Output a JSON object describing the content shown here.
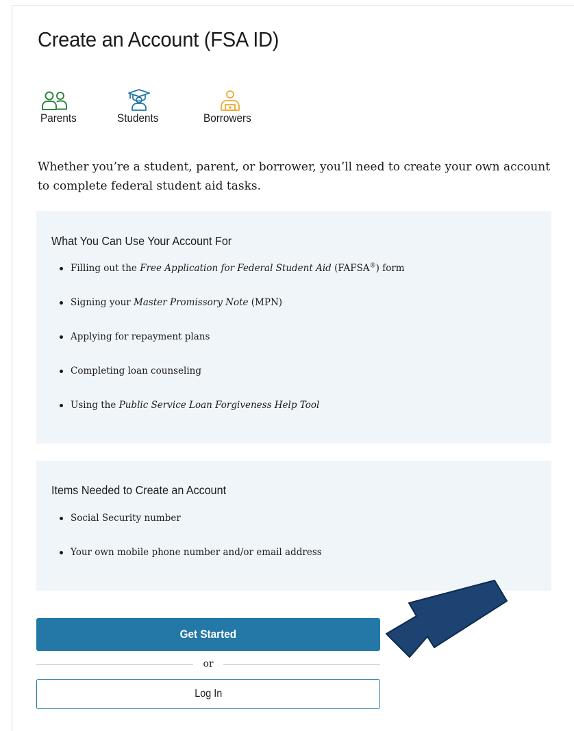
{
  "page": {
    "title": "Create an Account (FSA ID)",
    "intro": "Whether you’re a student, parent, or borrower, you’ll need to create your own account to complete federal student aid tasks."
  },
  "user_types": [
    {
      "label": "Parents",
      "icon": "parents-icon",
      "color": "#2e8540"
    },
    {
      "label": "Students",
      "icon": "graduation-cap-icon",
      "color": "#2378a8"
    },
    {
      "label": "Borrowers",
      "icon": "borrower-icon",
      "color": "#f0a830"
    }
  ],
  "uses_panel": {
    "heading": "What You Can Use Your Account For",
    "items": [
      {
        "before": "Filling out the ",
        "em": "Free Application for Federal Student Aid",
        "after": " (FAFSA",
        "sup": "®",
        "after2": ") form"
      },
      {
        "before": "Signing your ",
        "em": "Master Promissory Note",
        "after": " (MPN)"
      },
      {
        "text": "Applying for repayment plans"
      },
      {
        "text": "Completing loan counseling"
      },
      {
        "before": "Using the ",
        "em": "Public Service Loan Forgiveness Help Tool"
      }
    ]
  },
  "items_panel": {
    "heading": "Items Needed to Create an Account",
    "items": [
      {
        "text": "Social Security number"
      },
      {
        "text": "Your own mobile phone number and/or email address"
      }
    ]
  },
  "actions": {
    "get_started": "Get Started",
    "or": "or",
    "log_in": "Log In"
  },
  "colors": {
    "primary": "#2378a8",
    "panel_bg": "#f0f5f9",
    "arrow": "#1c4372"
  }
}
